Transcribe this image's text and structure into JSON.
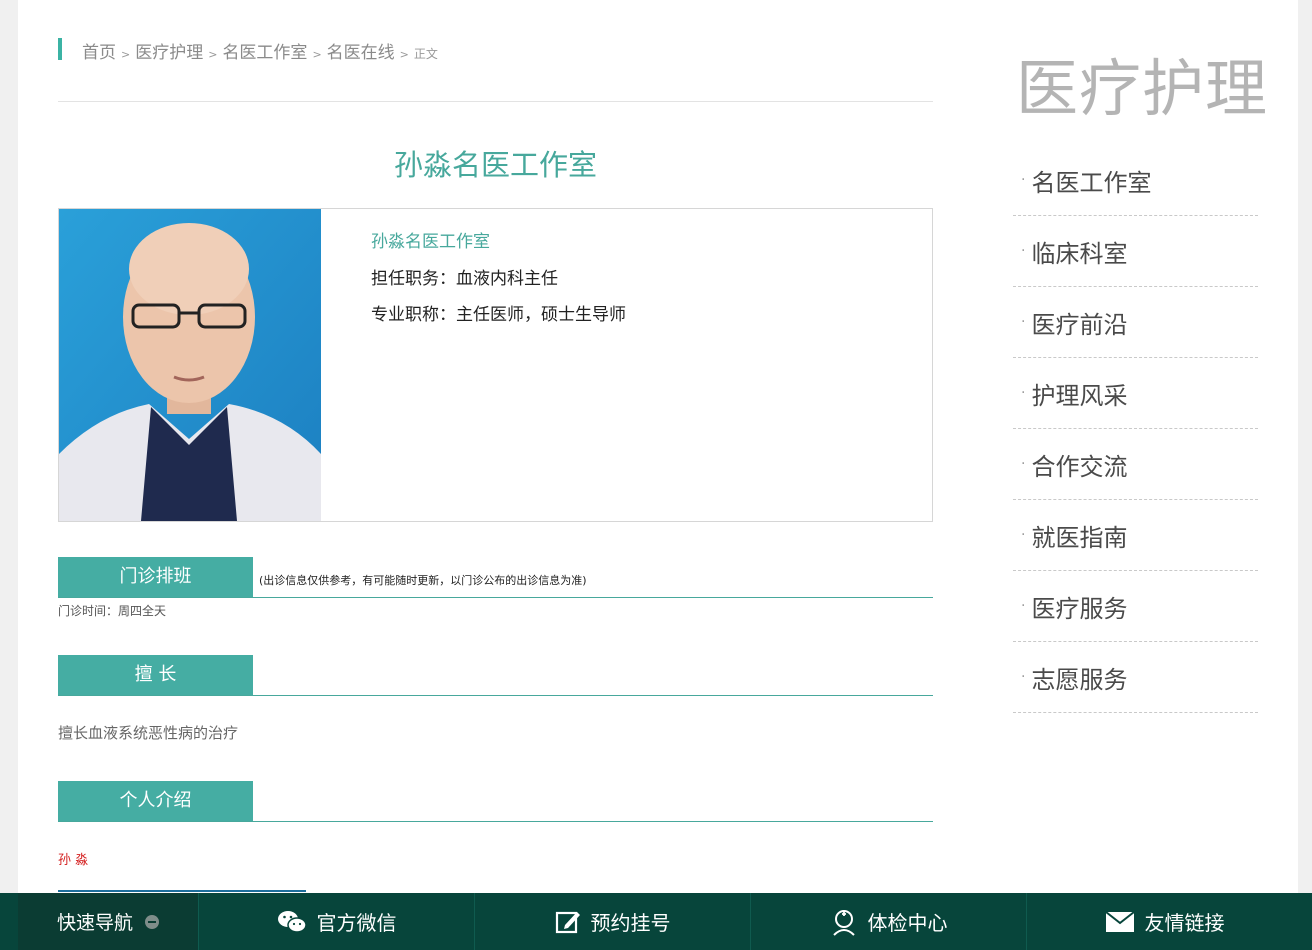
{
  "breadcrumb": {
    "items": [
      "首页",
      "医疗护理",
      "名医工作室",
      "名医在线"
    ],
    "separator": ">",
    "current": "正文"
  },
  "page_title": "孙淼名医工作室",
  "profile": {
    "name": "孙淼名医工作室",
    "position_label": "担任职务：",
    "position_value": "血液内科主任",
    "title_label": "专业职称：",
    "title_value": "主任医师，硕士生导师"
  },
  "schedule": {
    "tab": "门诊排班",
    "note": "(出诊信息仅供参考，有可能随时更新，以门诊公布的出诊信息为准)",
    "time": "门诊时间：周四全天"
  },
  "specialty": {
    "tab": "擅 长",
    "text": "擅长血液系统恶性病的治疗"
  },
  "intro": {
    "tab": "个人介绍",
    "text": "孙 淼"
  },
  "sidebar": {
    "title": "医疗护理",
    "items": [
      "名医工作室",
      "临床科室",
      "医疗前沿",
      "护理风采",
      "合作交流",
      "就医指南",
      "医疗服务",
      "志愿服务"
    ]
  },
  "bottom_nav": {
    "quick_nav": "快速导航",
    "items": [
      {
        "label": "官方微信",
        "icon": "wechat-icon"
      },
      {
        "label": "预约挂号",
        "icon": "edit-icon"
      },
      {
        "label": "体检中心",
        "icon": "nurse-icon"
      },
      {
        "label": "友情链接",
        "icon": "mail-icon"
      }
    ]
  },
  "colors": {
    "accent": "#45ada3",
    "bottom_bar": "#07453b",
    "highlight_red": "#d42020"
  }
}
